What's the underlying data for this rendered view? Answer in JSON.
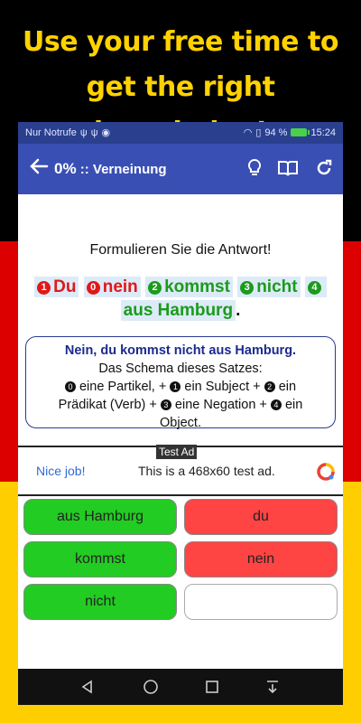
{
  "headline": {
    "line1": "Use your free time to",
    "line2": "get the right knowledge!"
  },
  "statusbar": {
    "carrier": "Nur Notrufe",
    "battery": "94 %",
    "time": "15:24"
  },
  "appbar": {
    "back_icon": "arrow-left-icon",
    "percent": "0%",
    "title": ":: Verneinung",
    "icons": [
      "lightbulb-icon",
      "book-icon",
      "refresh-icon"
    ]
  },
  "prompt": "Formulieren Sie die Antwort!",
  "answer_tokens": [
    {
      "num": "1",
      "word": "Du",
      "color": "red"
    },
    {
      "num": "0",
      "word": "nein",
      "color": "red"
    },
    {
      "num": "2",
      "word": "kommst",
      "color": "green"
    },
    {
      "num": "3",
      "word": "nicht",
      "color": "green"
    },
    {
      "num": "4",
      "word": "aus Hamburg",
      "color": "green"
    }
  ],
  "answer_end": ".",
  "explanation": {
    "sentence": "Nein, du kommst nicht aus Hamburg.",
    "schema": "Das Schema dieses Satzes:",
    "p0": "eine Partikel, +",
    "p1": "ein Subject +",
    "p2": "ein",
    "p2b": "Prädikat (Verb) +",
    "p3": "eine Negation +",
    "p4": "ein",
    "p4b": "Object.",
    "n0": "0",
    "n1": "1",
    "n2": "2",
    "n3": "3",
    "n4": "4"
  },
  "ad": {
    "tag": "Test Ad",
    "nice": "Nice job!",
    "text": "This is a 468x60 test ad."
  },
  "options": [
    {
      "label": "aus Hamburg",
      "state": "green"
    },
    {
      "label": "du",
      "state": "red"
    },
    {
      "label": "kommst",
      "state": "green"
    },
    {
      "label": "nein",
      "state": "red"
    },
    {
      "label": "nicht",
      "state": "green"
    },
    {
      "label": "",
      "state": "empty"
    }
  ],
  "colors": {
    "statusbar": "#2b3f8f",
    "appbar": "#3a4fb3",
    "green": "#22cc22",
    "red": "#ff4444",
    "flag_black": "#000000",
    "flag_red": "#dd0000",
    "flag_gold": "#ffce00"
  }
}
